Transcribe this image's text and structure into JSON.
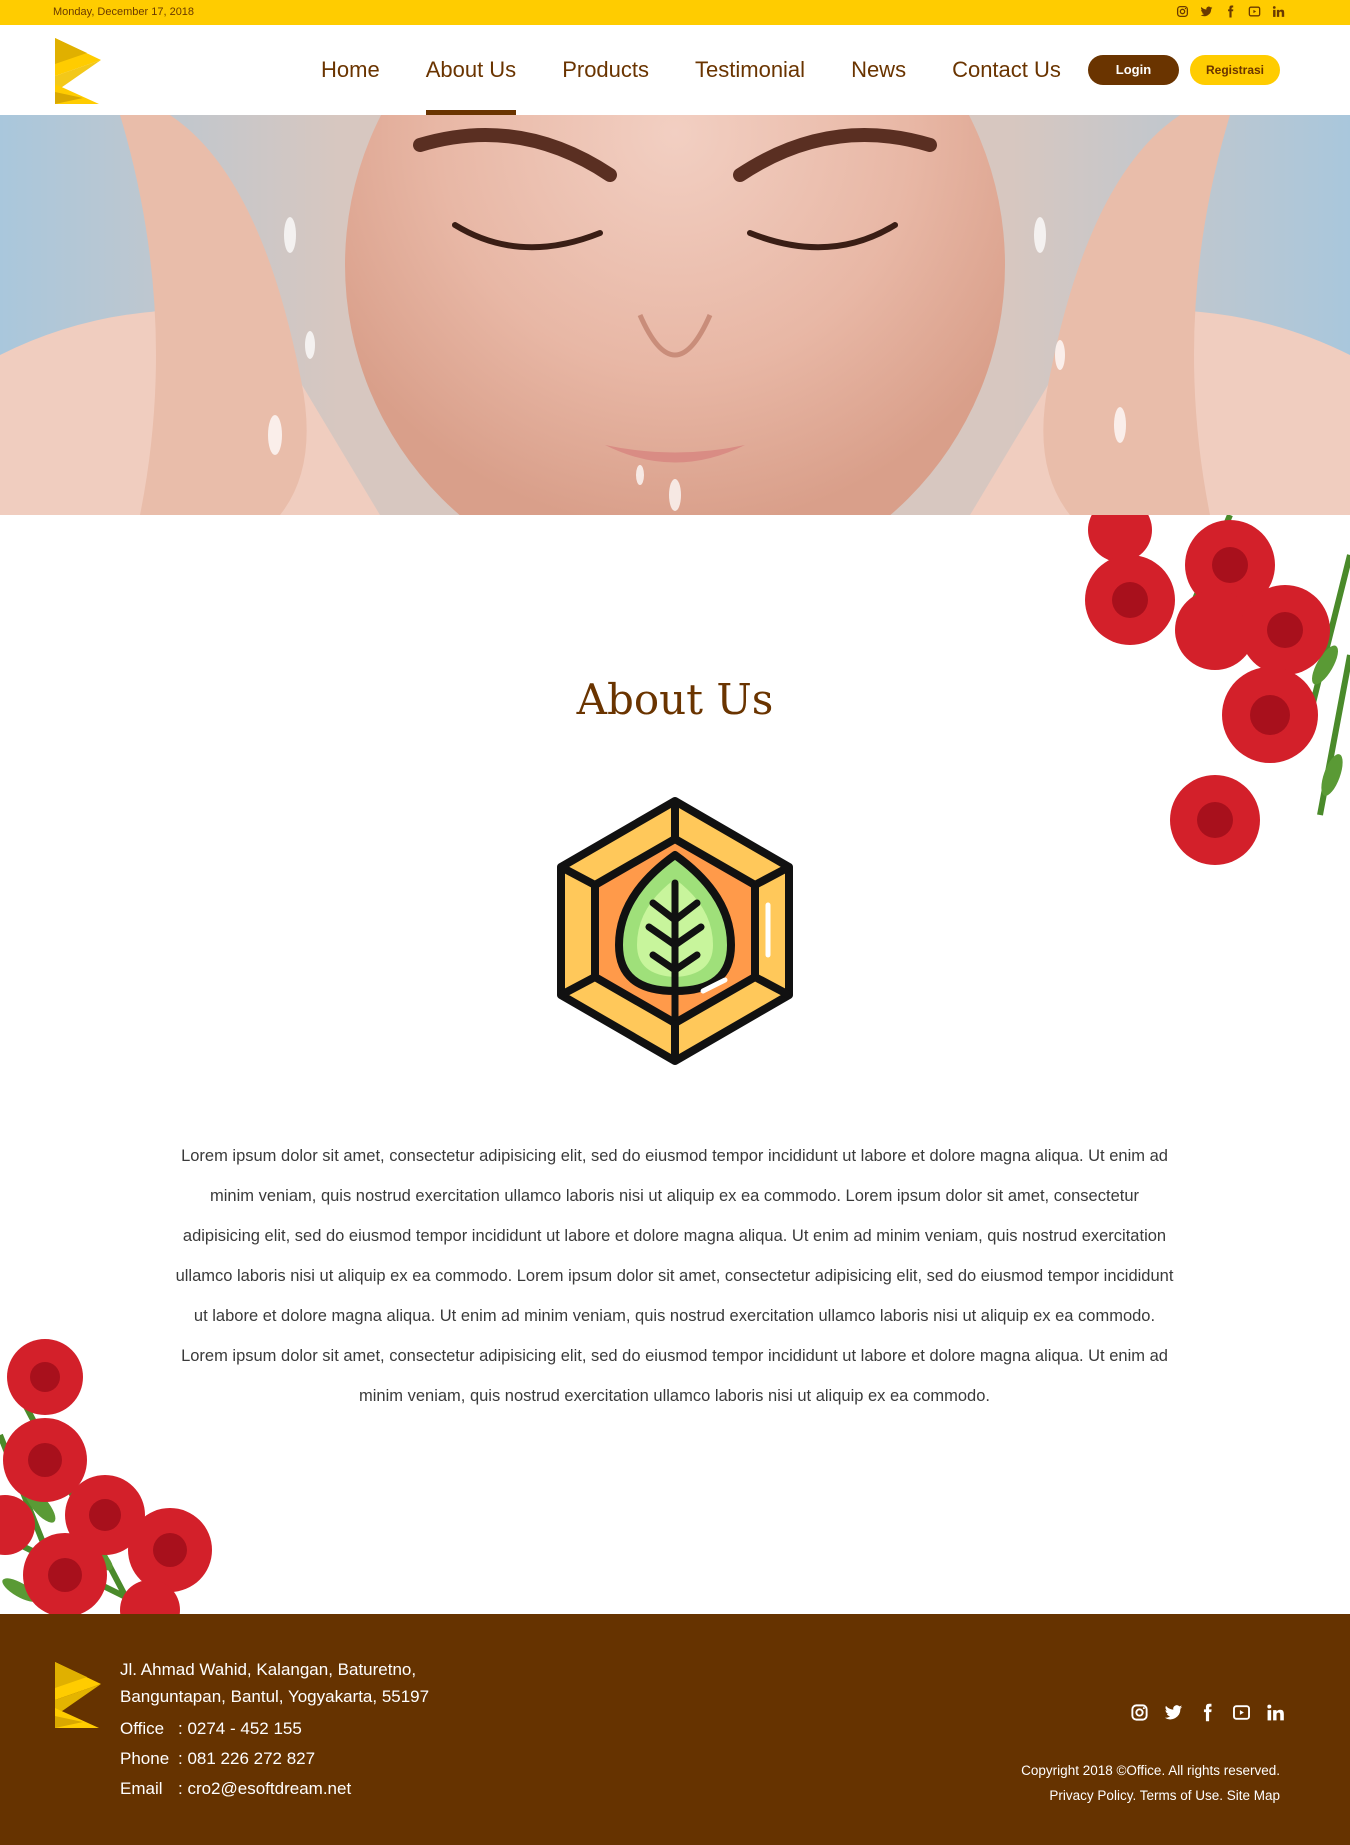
{
  "topbar": {
    "date": "Monday, December 17, 2018",
    "social_icons": [
      "instagram-icon",
      "twitter-icon",
      "facebook-icon",
      "youtube-icon",
      "linkedin-icon"
    ]
  },
  "nav": {
    "items": [
      {
        "label": "Home",
        "active": false
      },
      {
        "label": "About Us",
        "active": true
      },
      {
        "label": "Products",
        "active": false
      },
      {
        "label": "Testimonial",
        "active": false
      },
      {
        "label": "News",
        "active": false
      },
      {
        "label": "Contact Us",
        "active": false
      }
    ],
    "login_label": "Login",
    "register_label": "Registrasi"
  },
  "about": {
    "title": "About Us",
    "paragraph": "Lorem ipsum dolor sit amet, consectetur adipisicing elit, sed do eiusmod tempor incididunt ut labore et dolore magna aliqua. Ut enim ad minim veniam, quis nostrud exercitation ullamco laboris nisi ut aliquip ex ea commodo. Lorem ipsum dolor sit amet, consectetur adipisicing elit, sed do eiusmod tempor incididunt ut labore et dolore magna aliqua. Ut enim ad minim veniam, quis nostrud exercitation ullamco laboris nisi ut aliquip ex ea commodo.  Lorem ipsum dolor sit amet, consectetur adipisicing elit, sed do eiusmod tempor incididunt ut labore et dolore magna aliqua. Ut enim ad minim veniam, quis nostrud exercitation ullamco laboris nisi ut aliquip ex ea commodo. Lorem ipsum dolor sit amet, consectetur adipisicing elit, sed do eiusmod tempor incididunt ut labore et dolore magna aliqua. Ut enim ad minim veniam, quis nostrud exercitation ullamco laboris nisi ut aliquip ex ea commodo."
  },
  "footer": {
    "address_line1": "Jl. Ahmad Wahid, Kalangan, Baturetno,",
    "address_line2": "Banguntapan, Bantul, Yogyakarta, 55197",
    "contacts": [
      {
        "label": "Office",
        "value": ": 0274 - 452 155"
      },
      {
        "label": "Phone",
        "value": ": 081 226 272 827"
      },
      {
        "label": "Email",
        "value": ": cro2@esoftdream.net"
      }
    ],
    "social_icons": [
      "instagram-icon",
      "twitter-icon",
      "facebook-icon",
      "youtube-icon",
      "linkedin-icon"
    ],
    "copyright": "Copyright 2018 ©Office. All rights reserved.",
    "links": "Privacy Policy. Terms of Use. Site Map"
  },
  "colors": {
    "brand_yellow": "#ffcc00",
    "brand_brown": "#663300",
    "nav_text": "#6a3400"
  }
}
